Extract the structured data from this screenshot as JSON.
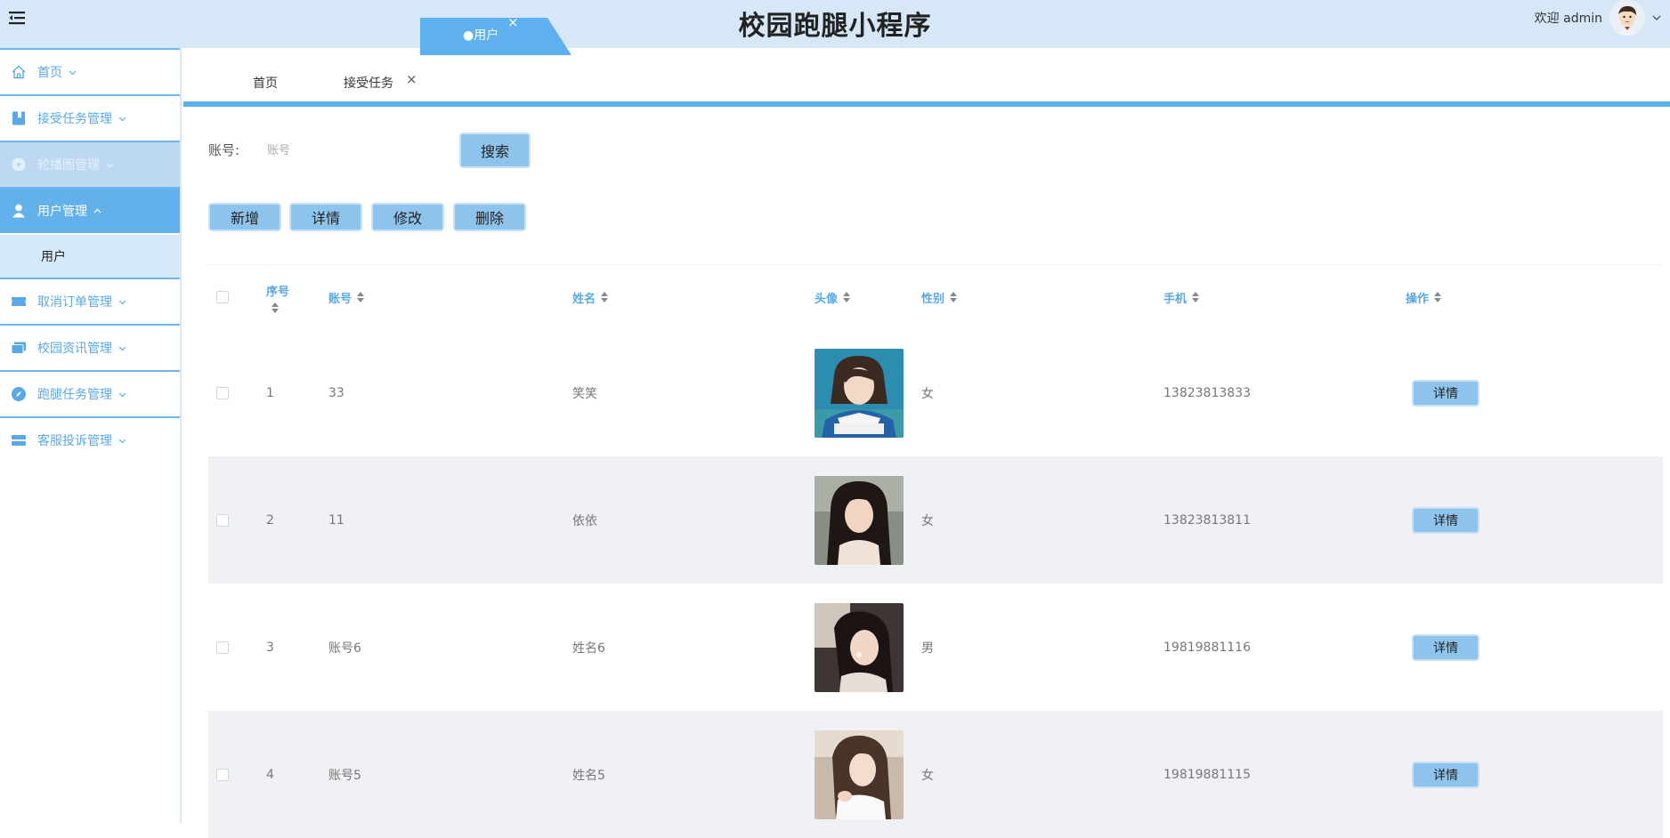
{
  "header": {
    "title": "校园跑腿小程序",
    "welcome": "欢迎 admin"
  },
  "sidebar": {
    "items": [
      {
        "label": "首页",
        "icon": "home-icon"
      },
      {
        "label": "接受任务管理",
        "icon": "bookmark-icon"
      },
      {
        "label": "轮播图管理",
        "icon": "disc-icon"
      },
      {
        "label": "用户管理",
        "icon": "user-icon"
      },
      {
        "label": "取消订单管理",
        "icon": "ticket-icon"
      },
      {
        "label": "校园资讯管理",
        "icon": "folders-icon"
      },
      {
        "label": "跑腿任务管理",
        "icon": "compass-icon"
      },
      {
        "label": "客服投诉管理",
        "icon": "server-icon"
      }
    ],
    "sub_item": "用户"
  },
  "tabs": {
    "home": "首页",
    "accept_task": "接受任务",
    "user": "●用户",
    "close": "×"
  },
  "search": {
    "label": "账号:",
    "placeholder": "账号",
    "button": "搜索"
  },
  "actions": {
    "add": "新增",
    "detail": "详情",
    "edit": "修改",
    "delete": "删除"
  },
  "table": {
    "columns": {
      "seq": "序号",
      "account": "账号",
      "name": "姓名",
      "avatar": "头像",
      "gender": "性别",
      "phone": "手机",
      "op": "操作"
    },
    "row_button": "详情",
    "rows": [
      {
        "seq": "1",
        "account": "33",
        "name": "笑笑",
        "gender": "女",
        "phone": "13823813833"
      },
      {
        "seq": "2",
        "account": "11",
        "name": "依依",
        "gender": "女",
        "phone": "13823813811"
      },
      {
        "seq": "3",
        "account": "账号6",
        "name": "姓名6",
        "gender": "男",
        "phone": "19819881116"
      },
      {
        "seq": "4",
        "account": "账号5",
        "name": "姓名5",
        "gender": "女",
        "phone": "19819881115"
      }
    ]
  },
  "colors": {
    "accent": "#5eb0ee",
    "header_bg": "#d6e7f7",
    "button_bg": "#8ec3ec"
  }
}
